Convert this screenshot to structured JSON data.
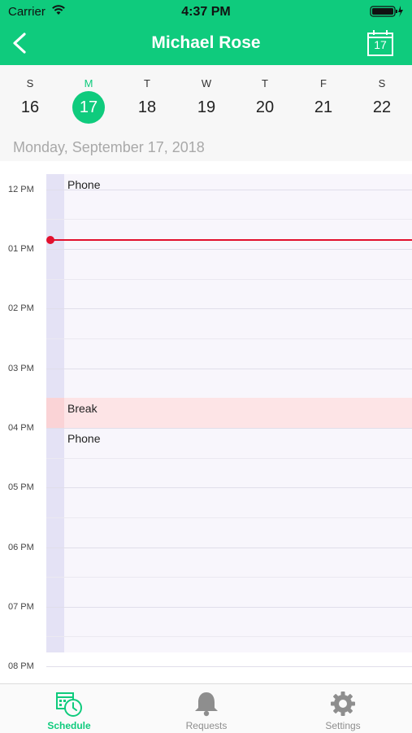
{
  "status_bar": {
    "carrier": "Carrier",
    "time": "4:37 PM"
  },
  "nav": {
    "title": "Michael Rose",
    "calendar_button_day": "17"
  },
  "week": {
    "days": [
      {
        "letter": "S",
        "num": "16"
      },
      {
        "letter": "M",
        "num": "17",
        "selected": true
      },
      {
        "letter": "T",
        "num": "18"
      },
      {
        "letter": "W",
        "num": "19"
      },
      {
        "letter": "T",
        "num": "20"
      },
      {
        "letter": "F",
        "num": "21"
      },
      {
        "letter": "S",
        "num": "22"
      }
    ]
  },
  "date_header": "Monday, September 17, 2018",
  "schedule": {
    "hours": [
      "12 PM",
      "01 PM",
      "02 PM",
      "03 PM",
      "04 PM",
      "05 PM",
      "06 PM",
      "07 PM",
      "08 PM"
    ],
    "events": [
      {
        "label": "Phone"
      },
      {
        "label": "Break"
      },
      {
        "label": "Phone"
      }
    ]
  },
  "tabs": [
    {
      "label": "Schedule",
      "icon": "schedule-icon",
      "active": true
    },
    {
      "label": "Requests",
      "icon": "bell-icon"
    },
    {
      "label": "Settings",
      "icon": "gear-icon"
    }
  ],
  "colors": {
    "accent": "#0fcb7d",
    "now_line": "#e2102d",
    "break_bg": "#fde4e6"
  }
}
